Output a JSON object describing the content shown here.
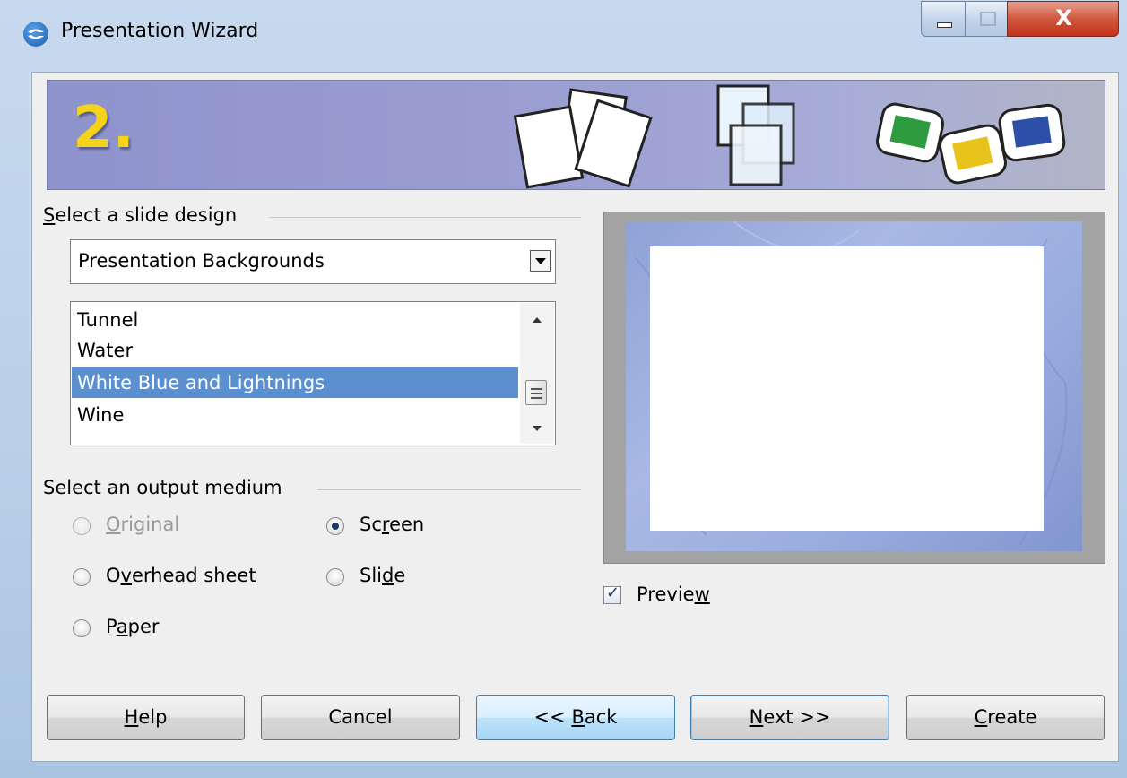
{
  "window": {
    "title": "Presentation Wizard",
    "controls": {
      "minimize": "minimize",
      "maximize": "maximize",
      "close": "X"
    }
  },
  "banner": {
    "step": "2."
  },
  "slide_design": {
    "group_label_prefix": "",
    "group_label_underlined": "S",
    "group_label_rest": "elect a slide design",
    "dropdown_value": "Presentation Backgrounds",
    "list_items": [
      "Tunnel",
      "Water",
      "White Blue and Lightnings",
      "Wine"
    ],
    "selected_index": 2
  },
  "output_medium": {
    "group_label": "Select an output medium",
    "options": [
      {
        "pre": "",
        "u": "O",
        "post": "riginal",
        "checked": false,
        "disabled": true
      },
      {
        "pre": "O",
        "u": "v",
        "post": "erhead sheet",
        "checked": false,
        "disabled": false
      },
      {
        "pre": "P",
        "u": "a",
        "post": "per",
        "checked": false,
        "disabled": false
      },
      {
        "pre": "Sc",
        "u": "r",
        "post": "een",
        "checked": true,
        "disabled": false
      },
      {
        "pre": "Sli",
        "u": "d",
        "post": "e",
        "checked": false,
        "disabled": false
      }
    ]
  },
  "preview": {
    "checkbox_pre": "Previe",
    "checkbox_u": "w",
    "checked": true
  },
  "buttons": {
    "help": {
      "u": "H",
      "post": "elp"
    },
    "cancel": "Cancel",
    "back": {
      "pre": "<< ",
      "u": "B",
      "post": "ack"
    },
    "next": {
      "u": "N",
      "post": "ext >>"
    },
    "create": {
      "u": "C",
      "post": "reate"
    }
  },
  "colors": {
    "selection": "#5b8fcf",
    "banner": "#9b9fd2",
    "step_number": "#f5d31a"
  }
}
